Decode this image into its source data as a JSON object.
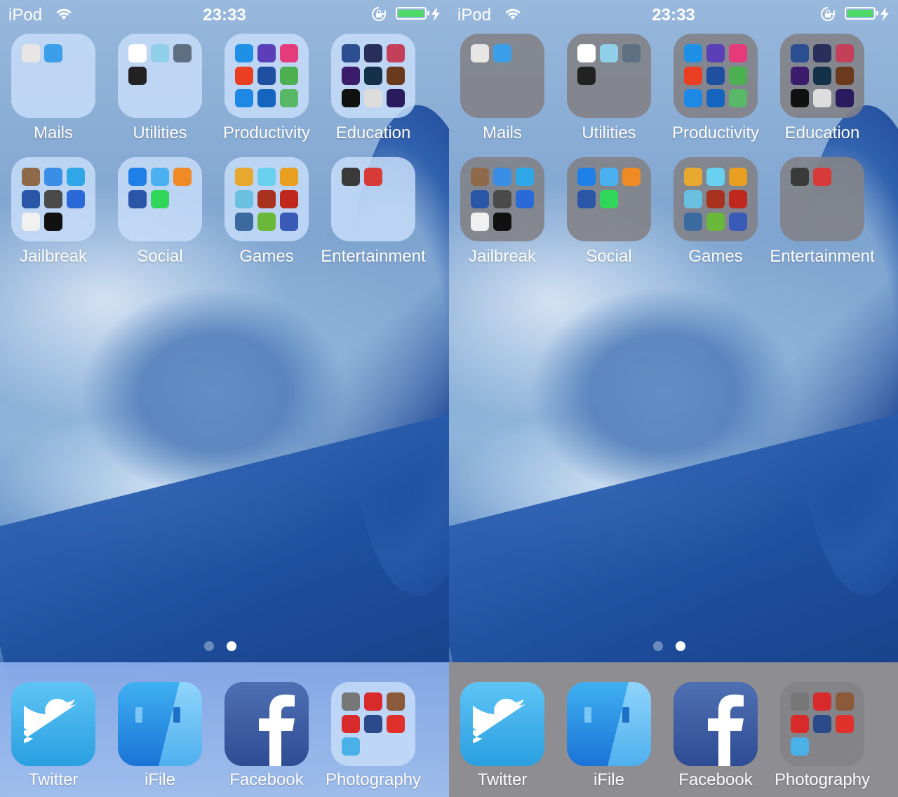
{
  "status": {
    "carrier": "iPod",
    "time": "23:33"
  },
  "folders": [
    {
      "name": "Mails",
      "icons": [
        "#e8e6e4",
        "#3a9fe8"
      ]
    },
    {
      "name": "Utilities",
      "icons": [
        "#ffffff",
        "#8fd0e8",
        "#5d6f80",
        "#222222"
      ]
    },
    {
      "name": "Productivity",
      "icons": [
        "#1e90e6",
        "#5a3fb8",
        "#e63b7a",
        "#ea3e23",
        "#1f4fa0",
        "#4caf50",
        "#1e88e5",
        "#1565c0",
        "#58b868"
      ]
    },
    {
      "name": "Education",
      "icons": [
        "#2b4e90",
        "#2a2e5a",
        "#c4405a",
        "#3a1c6a",
        "#13324a",
        "#6b3a1c",
        "#111111",
        "#dddddd",
        "#2a1a5e"
      ]
    },
    {
      "name": "Jailbreak",
      "icons": [
        "#8e6a4a",
        "#3a8ee6",
        "#2ea6e8",
        "#2a56a8",
        "#4a4a4a",
        "#2a6ad8",
        "#f0f0f0",
        "#111111"
      ]
    },
    {
      "name": "Social",
      "icons": [
        "#1e7fe8",
        "#4ab0f0",
        "#f08a24",
        "#2a56a8",
        "#2fd65a"
      ]
    },
    {
      "name": "Games",
      "icons": [
        "#e8a830",
        "#6ad0f0",
        "#e89e1e",
        "#6ac0e0",
        "#a8321e",
        "#c0281e",
        "#3a6a9e",
        "#6ab83a",
        "#3a5ab8"
      ]
    },
    {
      "name": "Entertainment",
      "icons": [
        "#3a3a3a",
        "#d83a3a"
      ]
    }
  ],
  "dock": [
    {
      "name": "Twitter",
      "icon": "twitter-bird-icon"
    },
    {
      "name": "iFile",
      "icon": "ifile-icon"
    },
    {
      "name": "Facebook",
      "icon": "facebook-f-icon"
    },
    {
      "name": "Photography",
      "icons": [
        "#777777",
        "#d82a2a",
        "#8a5a3a",
        "#d82a2a",
        "#2a4a8a",
        "#e0302a",
        "#4ab0e8"
      ]
    }
  ],
  "page_dots": {
    "count": 2,
    "current": 2
  }
}
